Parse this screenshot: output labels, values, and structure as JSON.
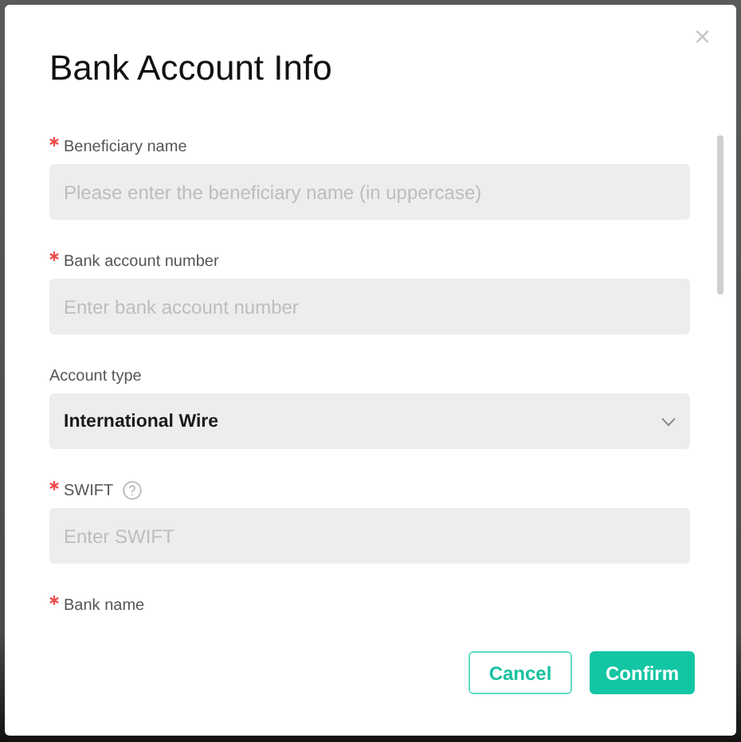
{
  "dialog": {
    "title": "Bank Account Info",
    "close": "×"
  },
  "fields": [
    {
      "kind": "text",
      "label": "Beneficiary name",
      "required": true,
      "help": false,
      "placeholder": "Please enter the beneficiary name (in uppercase)"
    },
    {
      "kind": "text",
      "label": "Bank account number",
      "required": true,
      "help": false,
      "placeholder": "Enter bank account number"
    },
    {
      "kind": "select",
      "label": "Account type",
      "required": false,
      "help": false,
      "value": "International Wire"
    },
    {
      "kind": "text",
      "label": "SWIFT",
      "required": true,
      "help": true,
      "placeholder": "Enter SWIFT"
    },
    {
      "kind": "label",
      "label": "Bank name",
      "required": true,
      "help": false
    }
  ],
  "buttons": [
    {
      "label": "Cancel",
      "kind": "secondary"
    },
    {
      "label": "Confirm",
      "kind": "primary"
    }
  ]
}
